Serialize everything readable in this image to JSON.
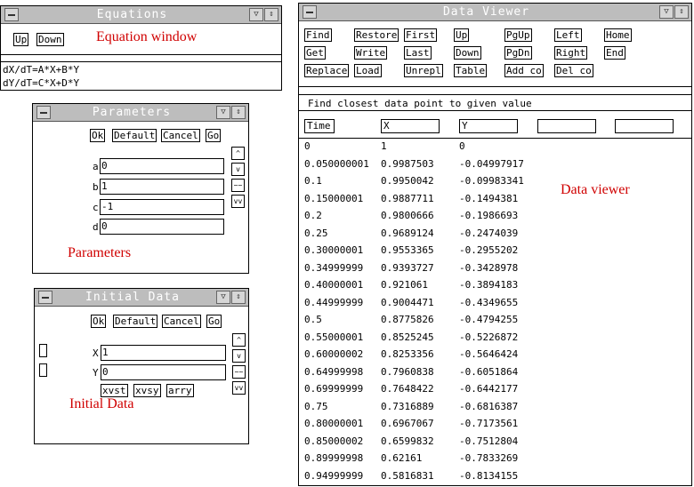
{
  "equations_window": {
    "title": "Equations",
    "buttons": [
      "Up",
      "Down"
    ],
    "equations": [
      "dX/dT=A*X+B*Y",
      "dY/dT=C*X+D*Y"
    ]
  },
  "parameters_window": {
    "title": "Parameters",
    "buttons": [
      "Ok",
      "Default",
      "Cancel",
      "Go"
    ],
    "params": [
      {
        "label": "a",
        "value": "0"
      },
      {
        "label": "b",
        "value": "1"
      },
      {
        "label": "c",
        "value": "-1"
      },
      {
        "label": "d",
        "value": "0"
      }
    ],
    "side_buttons": [
      "^",
      "v",
      "~~",
      "vv"
    ]
  },
  "initial_data_window": {
    "title": "Initial Data",
    "buttons": [
      "Ok",
      "Default",
      "Cancel",
      "Go"
    ],
    "vars": [
      {
        "label": "X",
        "value": "1"
      },
      {
        "label": "Y",
        "value": "0"
      }
    ],
    "plot_buttons": [
      "xvst",
      "xvsy",
      "arry"
    ],
    "side_buttons": [
      "^",
      "v",
      "~~",
      "vv"
    ]
  },
  "data_viewer": {
    "title": "Data Viewer",
    "buttons_row1": [
      "Find",
      "Restore",
      "First",
      "Up",
      "PgUp",
      "Left",
      "Home"
    ],
    "buttons_row2": [
      "Get",
      "Write",
      "Last",
      "Down",
      "PgDn",
      "Right",
      "End"
    ],
    "buttons_row3": [
      "Replace",
      "Load",
      "Unrepl",
      "Table",
      "Add co",
      "Del co"
    ],
    "status": "Find closest data point to given value",
    "columns": [
      "Time",
      "X",
      "Y",
      "",
      ""
    ],
    "rows": [
      [
        "0",
        "1",
        "0"
      ],
      [
        "0.050000001",
        "0.9987503",
        "-0.04997917"
      ],
      [
        "0.1",
        "0.9950042",
        "-0.09983341"
      ],
      [
        "0.15000001",
        "0.9887711",
        "-0.1494381"
      ],
      [
        "0.2",
        "0.9800666",
        "-0.1986693"
      ],
      [
        "0.25",
        "0.9689124",
        "-0.2474039"
      ],
      [
        "0.30000001",
        "0.9553365",
        "-0.2955202"
      ],
      [
        "0.34999999",
        "0.9393727",
        "-0.3428978"
      ],
      [
        "0.40000001",
        "0.921061",
        "-0.3894183"
      ],
      [
        "0.44999999",
        "0.9004471",
        "-0.4349655"
      ],
      [
        "0.5",
        "0.8775826",
        "-0.4794255"
      ],
      [
        "0.55000001",
        "0.8525245",
        "-0.5226872"
      ],
      [
        "0.60000002",
        "0.8253356",
        "-0.5646424"
      ],
      [
        "0.64999998",
        "0.7960838",
        "-0.6051864"
      ],
      [
        "0.69999999",
        "0.7648422",
        "-0.6442177"
      ],
      [
        "0.75",
        "0.7316889",
        "-0.6816387"
      ],
      [
        "0.80000001",
        "0.6967067",
        "-0.7173561"
      ],
      [
        "0.85000002",
        "0.6599832",
        "-0.7512804"
      ],
      [
        "0.89999998",
        "0.62161",
        "-0.7833269"
      ],
      [
        "0.94999999",
        "0.5816831",
        "-0.8134155"
      ]
    ]
  },
  "annotations": {
    "equation_window": "Equation window",
    "parameters": "Parameters",
    "initial_data": "Initial Data",
    "data_viewer": "Data viewer"
  },
  "colors": {
    "titlebar": "#bdbdbd",
    "annotation": "#d00000"
  }
}
